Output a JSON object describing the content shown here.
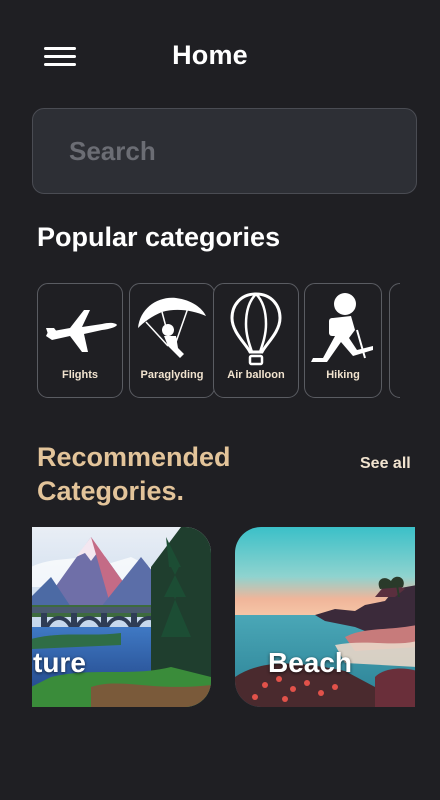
{
  "header": {
    "title": "Home",
    "menu_icon": "hamburger-menu-icon"
  },
  "search": {
    "placeholder": "Search",
    "value": ""
  },
  "popular": {
    "title": "Popular categories",
    "items": [
      {
        "label": "Flights",
        "icon": "airplane-icon"
      },
      {
        "label": "Paraglyding",
        "icon": "paraglider-icon"
      },
      {
        "label": "Air balloon",
        "icon": "hot-air-balloon-icon"
      },
      {
        "label": "Hiking",
        "icon": "hiker-icon"
      },
      {
        "label": "",
        "icon": "partial-category-icon"
      }
    ]
  },
  "recommended": {
    "title_line1": "Recommended",
    "title_line2": "Categories.",
    "see_all": "See all",
    "items": [
      {
        "label": "ture",
        "image": "mountain-lake-bridge-illustration"
      },
      {
        "label": "Beach",
        "image": "coastal-sunset-illustration"
      }
    ]
  },
  "colors": {
    "background": "#1f1f23",
    "search_bg": "#2d2f35",
    "accent": "#e3c49a",
    "label": "#f1e3cf"
  }
}
